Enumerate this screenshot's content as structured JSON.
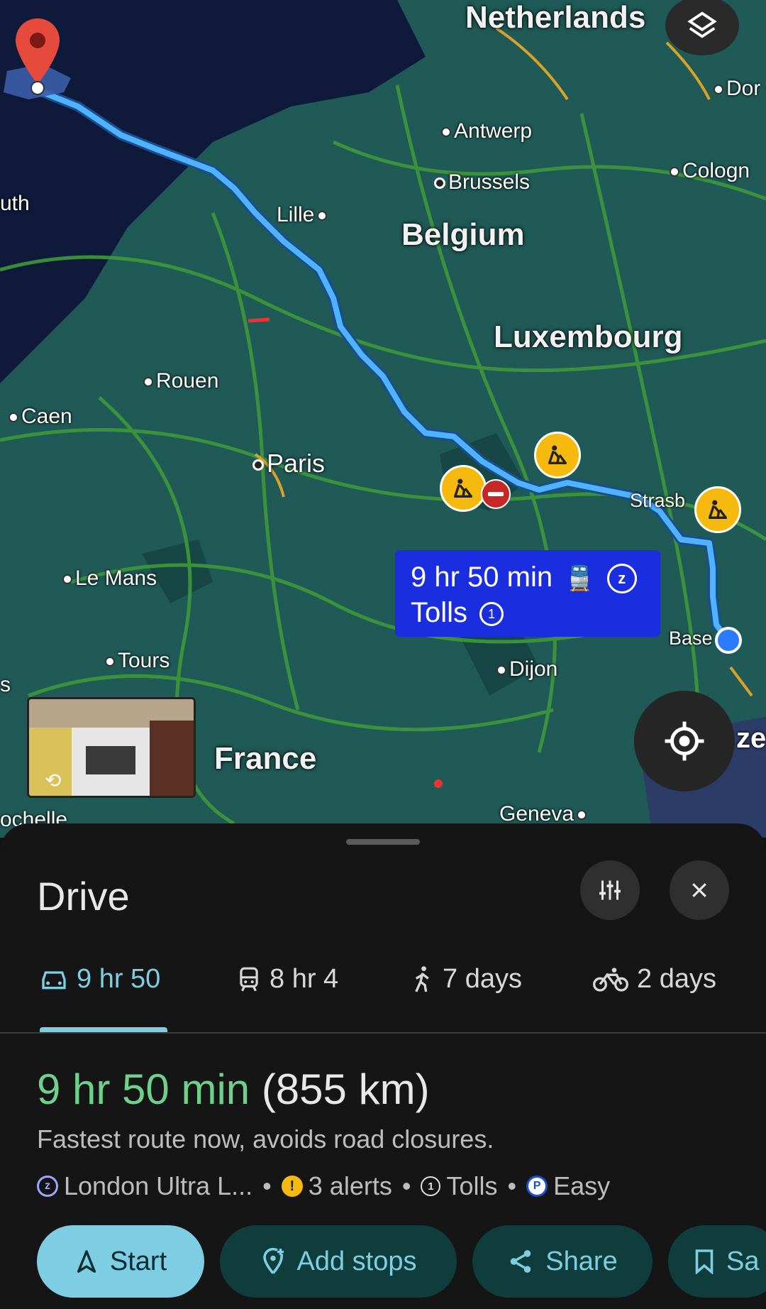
{
  "map": {
    "countries": [
      "Netherlands",
      "Belgium",
      "Luxembourg",
      "France"
    ],
    "cities": [
      "Antwerp",
      "Brussels",
      "Lille",
      "Rouen",
      "Caen",
      "Paris",
      "Le Mans",
      "Tours",
      "Dijon",
      "Strasb",
      "Base",
      "Geneva",
      "Cologn",
      "Dor",
      "uth",
      "ochelle",
      "s",
      "ze"
    ],
    "route_callout": {
      "duration": "9 hr 50 min",
      "tolls": "Tolls"
    },
    "icons": [
      "layers-icon",
      "my-location-icon",
      "destination-pin-icon",
      "roadwork-icon",
      "no-entry-icon",
      "street-view-thumbnail"
    ]
  },
  "sheet": {
    "title": "Drive",
    "modes": [
      {
        "label": "9 hr 50",
        "icon": "car-icon"
      },
      {
        "label": "8 hr 4",
        "icon": "train-icon"
      },
      {
        "label": "7 days",
        "icon": "walk-icon"
      },
      {
        "label": "2 days",
        "icon": "bike-icon"
      }
    ],
    "eta": {
      "time": "9 hr 50 min",
      "distance": "(855 km)"
    },
    "description": "Fastest route now, avoids road closures.",
    "chips": {
      "zone": "London Ultra L...",
      "alerts": "3 alerts",
      "tolls": "Tolls",
      "parking": "Easy"
    },
    "buttons": {
      "start": "Start",
      "add_stops": "Add stops",
      "share": "Share",
      "save": "Sa"
    }
  },
  "colors": {
    "route": "#4fb3ff",
    "eta_green": "#6fd08c",
    "accent": "#7dcde3",
    "callout": "#1a2ee0"
  }
}
